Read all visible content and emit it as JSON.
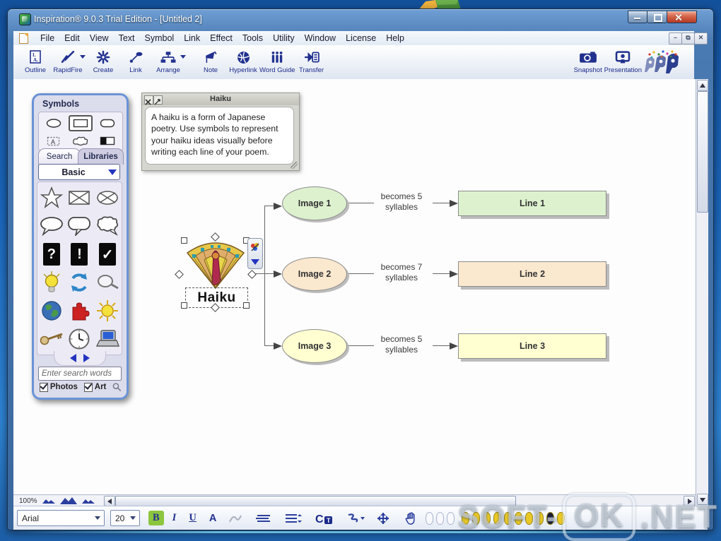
{
  "window": {
    "title": "Inspiration® 9.0.3 Trial Edition - [Untitled 2]"
  },
  "menu": {
    "items": [
      "File",
      "Edit",
      "View",
      "Text",
      "Symbol",
      "Link",
      "Effect",
      "Tools",
      "Utility",
      "Window",
      "License",
      "Help"
    ]
  },
  "toolbar": {
    "items": [
      {
        "label": "Outline"
      },
      {
        "label": "RapidFire",
        "dropdown": true
      },
      {
        "label": "Create"
      },
      {
        "label": "Link"
      },
      {
        "label": "Arrange",
        "dropdown": true
      },
      {
        "label": "Note"
      },
      {
        "label": "Hyperlink"
      },
      {
        "label": "Word Guide"
      },
      {
        "label": "Transfer"
      }
    ],
    "right_items": [
      {
        "label": "Snapshot"
      },
      {
        "label": "Presentation"
      }
    ]
  },
  "palette": {
    "title": "Symbols",
    "tabs": [
      "Search",
      "Libraries"
    ],
    "library_selected": "Basic",
    "search_placeholder": "Enter search words",
    "tiles": [
      "?",
      "!",
      "✓"
    ],
    "checkboxes": [
      {
        "label": "Photos",
        "checked": true
      },
      {
        "label": "Art",
        "checked": true
      }
    ]
  },
  "note": {
    "title": "Haiku",
    "text": "A haiku is a form of Japanese poetry. Use symbols to represent your haiku ideas visually before writing each line of your poem."
  },
  "diagram": {
    "center_label": "Haiku",
    "rows": [
      {
        "image_label": "Image 1",
        "link_line1": "becomes 5",
        "link_line2": "syllables",
        "line_label": "Line 1",
        "fill": "#ddf1cf"
      },
      {
        "image_label": "Image 2",
        "link_line1": "becomes 7",
        "link_line2": "syllables",
        "line_label": "Line 2",
        "fill": "#fae8cf"
      },
      {
        "image_label": "Image 3",
        "link_line1": "becomes 5",
        "link_line2": "syllables",
        "line_label": "Line 3",
        "fill": "#ffffd2"
      }
    ]
  },
  "statusbar": {
    "zoom": "100%"
  },
  "format_toolbar": {
    "font": "Arial",
    "size": "20",
    "bold": "B",
    "italic": "I",
    "underline": "U",
    "color_letter": "A",
    "bold_active_color": "#8cc63e",
    "indicator_ovals": [
      "#e9c826",
      "#e9c826",
      "#e9c826",
      "#e9c826",
      "#e9c826",
      "#e9c826",
      "#e9c826",
      "#e9c826",
      "#1c1c34",
      "#e9c826"
    ]
  },
  "watermark": {
    "part1": "SOFT-",
    "part2": "OK",
    "part3": ".NET"
  },
  "colors": {
    "icon_navy": "#22318f",
    "titlebar_blue": "#3a689e",
    "palette_border": "#6a93d6"
  }
}
